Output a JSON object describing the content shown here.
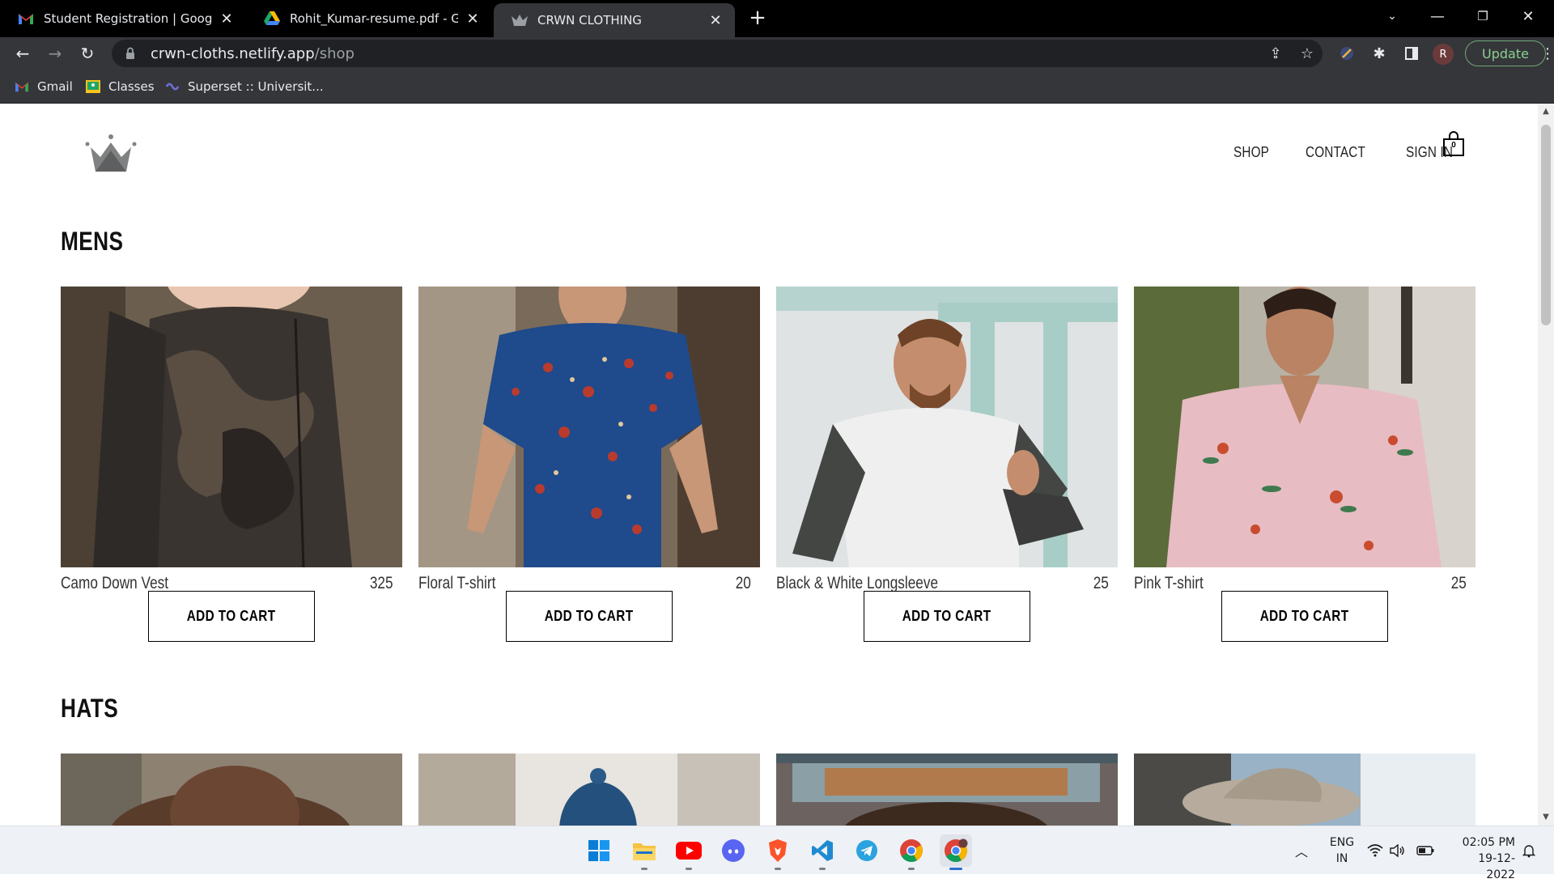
{
  "browser": {
    "tabs": [
      {
        "title": "Student Registration | Google ST",
        "icon": "gmail-icon"
      },
      {
        "title": "Rohit_Kumar-resume.pdf - Googl",
        "icon": "google-drive-icon"
      },
      {
        "title": "CRWN CLOTHING",
        "icon": "crown-icon",
        "active": true
      }
    ],
    "url_host": "crwn-cloths.netlify.app",
    "url_path": "/shop",
    "profile_initial": "R",
    "update_label": "Update",
    "bookmarks": [
      {
        "label": "Gmail",
        "icon": "gmail-icon"
      },
      {
        "label": "Classes",
        "icon": "google-classroom-icon"
      },
      {
        "label": "Superset :: Universit...",
        "icon": "superset-icon"
      }
    ]
  },
  "site": {
    "nav": {
      "shop": "SHOP",
      "contact": "CONTACT",
      "sign_in": "SIGN IN",
      "cart_count": "0"
    },
    "sections": [
      {
        "title": "MENS",
        "items": [
          {
            "name": "Camo Down Vest",
            "price": "325",
            "button": "ADD TO CART"
          },
          {
            "name": "Floral T-shirt",
            "price": "20",
            "button": "ADD TO CART"
          },
          {
            "name": "Black & White Longsleeve",
            "price": "25",
            "button": "ADD TO CART"
          },
          {
            "name": "Pink T-shirt",
            "price": "25",
            "button": "ADD TO CART"
          }
        ]
      },
      {
        "title": "HATS"
      }
    ]
  },
  "taskbar": {
    "lang_line1": "ENG",
    "lang_line2": "IN",
    "time": "02:05 PM",
    "date": "19-12-2022"
  }
}
